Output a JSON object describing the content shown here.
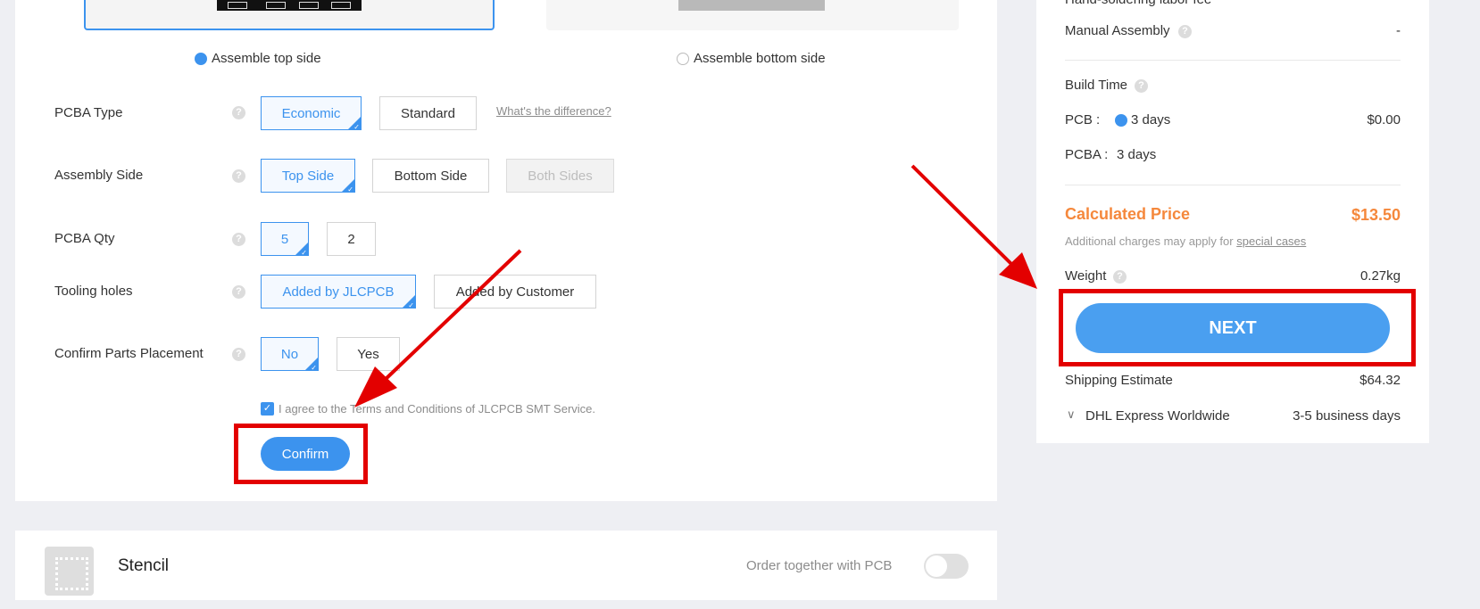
{
  "assembly": {
    "top_side_label": "Assemble top side",
    "bottom_side_label": "Assemble bottom side"
  },
  "rows": {
    "pcba_type": {
      "label": "PCBA Type",
      "options": [
        "Economic",
        "Standard"
      ],
      "link": "What's the difference?"
    },
    "assembly_side": {
      "label": "Assembly Side",
      "options": [
        "Top Side",
        "Bottom Side",
        "Both Sides"
      ]
    },
    "pcba_qty": {
      "label": "PCBA Qty",
      "options": [
        "5",
        "2"
      ]
    },
    "tooling_holes": {
      "label": "Tooling holes",
      "options": [
        "Added by JLCPCB",
        "Added by Customer"
      ]
    },
    "confirm_parts": {
      "label": "Confirm Parts Placement",
      "options": [
        "No",
        "Yes"
      ]
    }
  },
  "agree_text": "I agree to the Terms and Conditions of JLCPCB SMT Service.",
  "confirm_label": "Confirm",
  "stencil": {
    "title": "Stencil",
    "order_together": "Order together with PCB"
  },
  "sidebar": {
    "hand_soldering_partial": "Hand-soldering labor fee",
    "manual_assembly_label": "Manual Assembly",
    "manual_assembly_value": "-",
    "build_time_label": "Build Time",
    "pcb_label": "PCB :",
    "pcb_days": "3 days",
    "pcb_price": "$0.00",
    "pcba_label": "PCBA :",
    "pcba_days": "3 days",
    "calculated_price_label": "Calculated Price",
    "calculated_price_value": "$13.50",
    "additional_charges": "Additional charges may apply for",
    "special_cases": "special cases",
    "weight_label": "Weight",
    "weight_value": "0.27kg",
    "next_label": "NEXT",
    "shipping_estimate_label": "Shipping Estimate",
    "shipping_estimate_value": "$64.32",
    "shipping_method": "DHL Express Worldwide",
    "shipping_time": "3-5 business days"
  },
  "colors": {
    "accent": "#3c93ee",
    "price_orange": "#f5883c",
    "annotation_red": "#e30000"
  }
}
